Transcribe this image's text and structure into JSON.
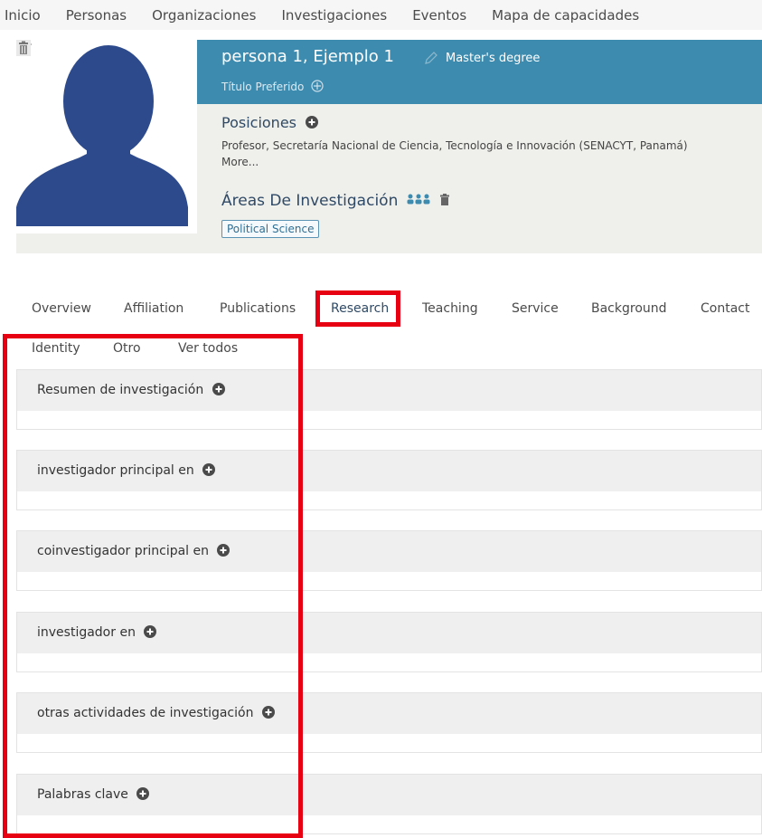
{
  "nav": {
    "items": [
      "Inicio",
      "Personas",
      "Organizaciones",
      "Investigaciones",
      "Eventos",
      "Mapa de capacidades"
    ]
  },
  "profile": {
    "name": "persona 1, Ejemplo 1",
    "degree": "Master's degree",
    "preferred_title_label": "Título Preferido",
    "positions_heading": "Posiciones",
    "positions_text": "Profesor, Secretaría Nacional de Ciencia, Tecnología e Innovación (SENACYT, Panamá)",
    "more_link": "More...",
    "research_areas_heading": "Áreas De Investigación",
    "research_area_tag": "Political Science"
  },
  "tabs": {
    "row1": [
      "Overview",
      "Affiliation",
      "Publications",
      "Research",
      "Teaching",
      "Service",
      "Background",
      "Contact"
    ],
    "row2": [
      "Identity",
      "Otro",
      "Ver todos"
    ],
    "active": "Research"
  },
  "sections": [
    {
      "title": "Resumen de investigación"
    },
    {
      "title": "investigador principal en"
    },
    {
      "title": "coinvestigador principal en"
    },
    {
      "title": "investigador en"
    },
    {
      "title": "otras actividades de investigación"
    },
    {
      "title": "Palabras clave"
    }
  ],
  "colors": {
    "name_bar": "#3d8cb0",
    "highlight": "#e60012",
    "avatar": "#2d4a8c"
  },
  "icons": [
    "pencil-icon",
    "trash-icon",
    "plus-circle-icon",
    "people-icon",
    "globe-icon",
    "avatar-silhouette-icon"
  ]
}
